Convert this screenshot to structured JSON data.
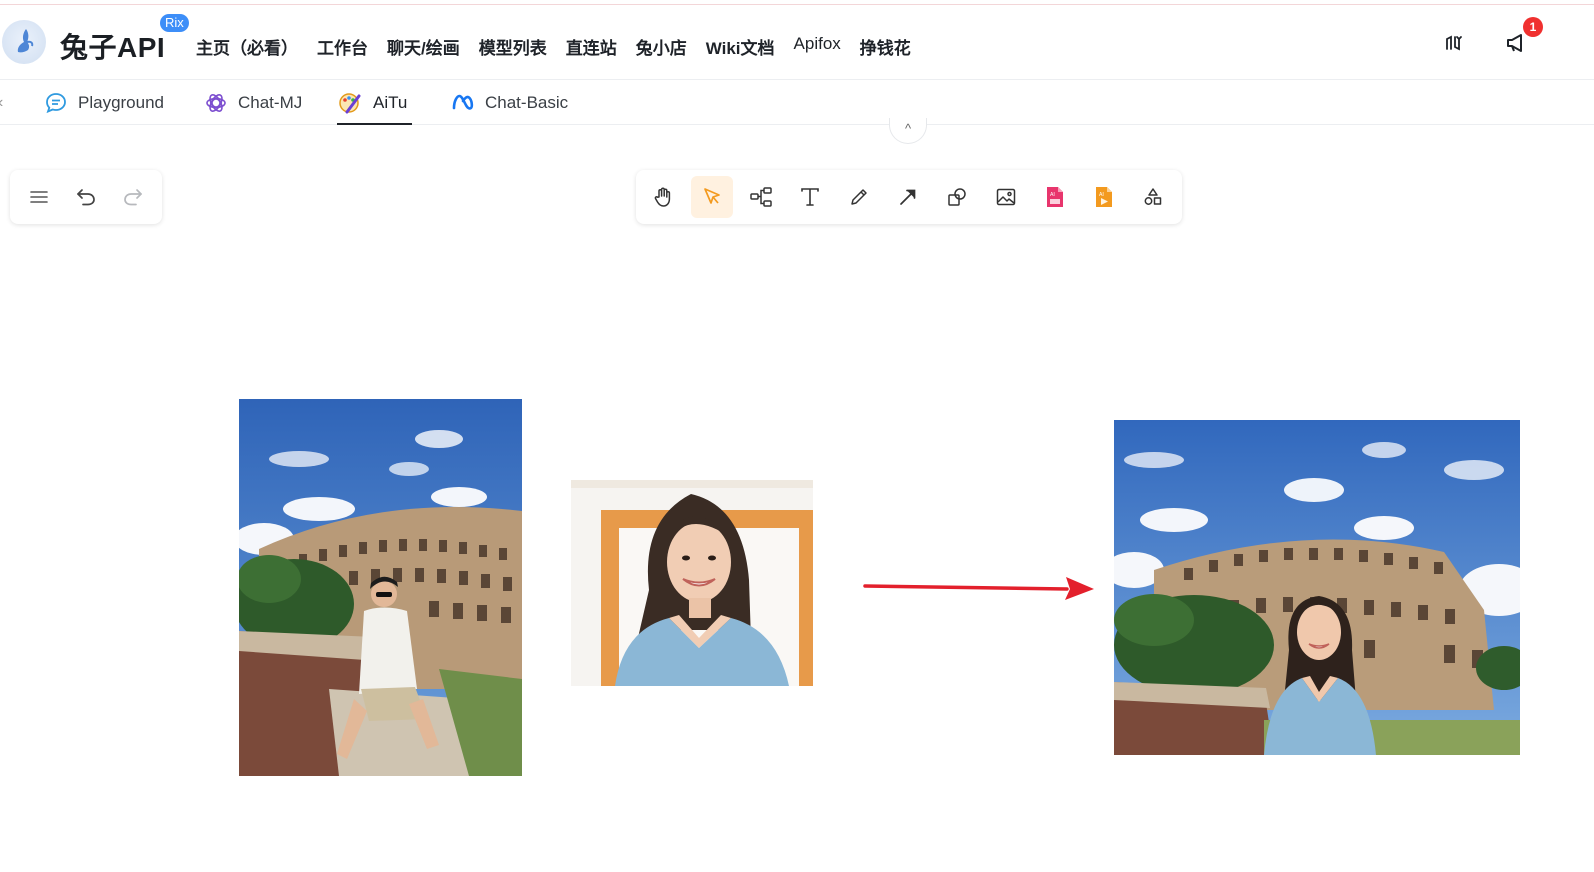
{
  "header": {
    "brand": "兔子API",
    "badge": "Rix",
    "nav": [
      "主页（必看）",
      "工作台",
      "聊天/绘画",
      "模型列表",
      "直连站",
      "兔小店",
      "Wiki文档",
      "Apifox",
      "挣钱花"
    ],
    "notification_count": "1",
    "icons": [
      "logo-icon",
      "translate-icon",
      "megaphone-icon"
    ]
  },
  "tabs": [
    {
      "label": "Playground",
      "icon": "chat-bubble-icon",
      "active": false
    },
    {
      "label": "Chat-MJ",
      "icon": "openai-icon",
      "active": false
    },
    {
      "label": "AiTu",
      "icon": "palette-icon",
      "active": true
    },
    {
      "label": "Chat-Basic",
      "icon": "meta-icon",
      "active": false
    }
  ],
  "left_toolbar": [
    "menu-icon",
    "undo-icon",
    "redo-icon"
  ],
  "main_toolbar": {
    "tools": [
      "hand-icon",
      "pointer-icon",
      "mindmap-icon",
      "text-icon",
      "pencil-icon",
      "arrow-icon",
      "shapes-icon",
      "image-icon",
      "ai-image-icon",
      "ai-video-icon",
      "more-shapes-icon"
    ],
    "selected": "pointer-icon",
    "accent": "#f39a1f"
  },
  "canvas": {
    "images": [
      "colosseum-man-photo",
      "woman-portrait-photo",
      "colosseum-woman-result-photo"
    ],
    "arrow_color": "#e3202c"
  }
}
